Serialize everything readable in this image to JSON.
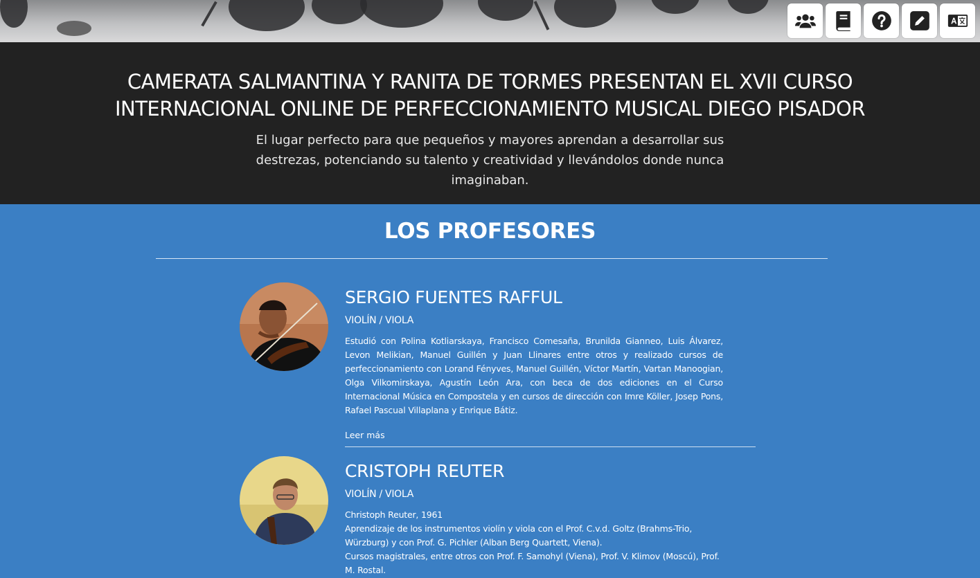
{
  "toolbar": {
    "icons": [
      "users-icon",
      "book-icon",
      "help-icon",
      "edit-icon",
      "translate-icon"
    ]
  },
  "header": {
    "title": "CAMERATA SALMANTINA Y RANITA DE TORMES PRESENTAN EL XVII CURSO INTERNACIONAL ONLINE DE PERFECCIONAMIENTO MUSICAL DIEGO PISADOR",
    "subtitle": "El lugar perfecto para que pequeños y mayores aprendan a desarrollar sus destrezas, potenciando su talento y creatividad y llevándolos donde nunca imaginaban."
  },
  "section": {
    "title": "LOS PROFESORES"
  },
  "teachers": [
    {
      "name": "SERGIO FUENTES RAFFUL",
      "instrument": "VIOLÍN / VIOLA",
      "bio": [
        "Estudió con Polina Kotliarskaya, Francisco Comesaña, Brunilda Gianneo, Luis Álvarez, Levon Melikian, Manuel Guillén y Juan Llinares entre otros y realizado cursos de perfeccionamiento con Lorand Fényves, Manuel Guillén, Víctor Martín, Vartan Manoogian, Olga Vilkomirskaya, Agustín León Ara, con beca de dos ediciones en el Curso Internacional Música en Compostela y en cursos de dirección con Imre Köller, Josep Pons, Rafael Pascual Villaplana y Enrique Bátiz."
      ],
      "read_more": "Leer más"
    },
    {
      "name": "CRISTOPH REUTER",
      "instrument": "VIOLÍN / VIOLA",
      "bio": [
        "Christoph Reuter, 1961",
        "Aprendizaje de los instrumentos violín y viola con el Prof. C.v.d. Goltz (Brahms-Trio, Würzburg) y con Prof. G. Pichler (Alban Berg Quartett, Viena).",
        "Cursos magistrales, entre otros con Prof. F. Samohyl (Viena), Prof. V. Klimov (Moscú), Prof. M. Rostal."
      ]
    }
  ]
}
